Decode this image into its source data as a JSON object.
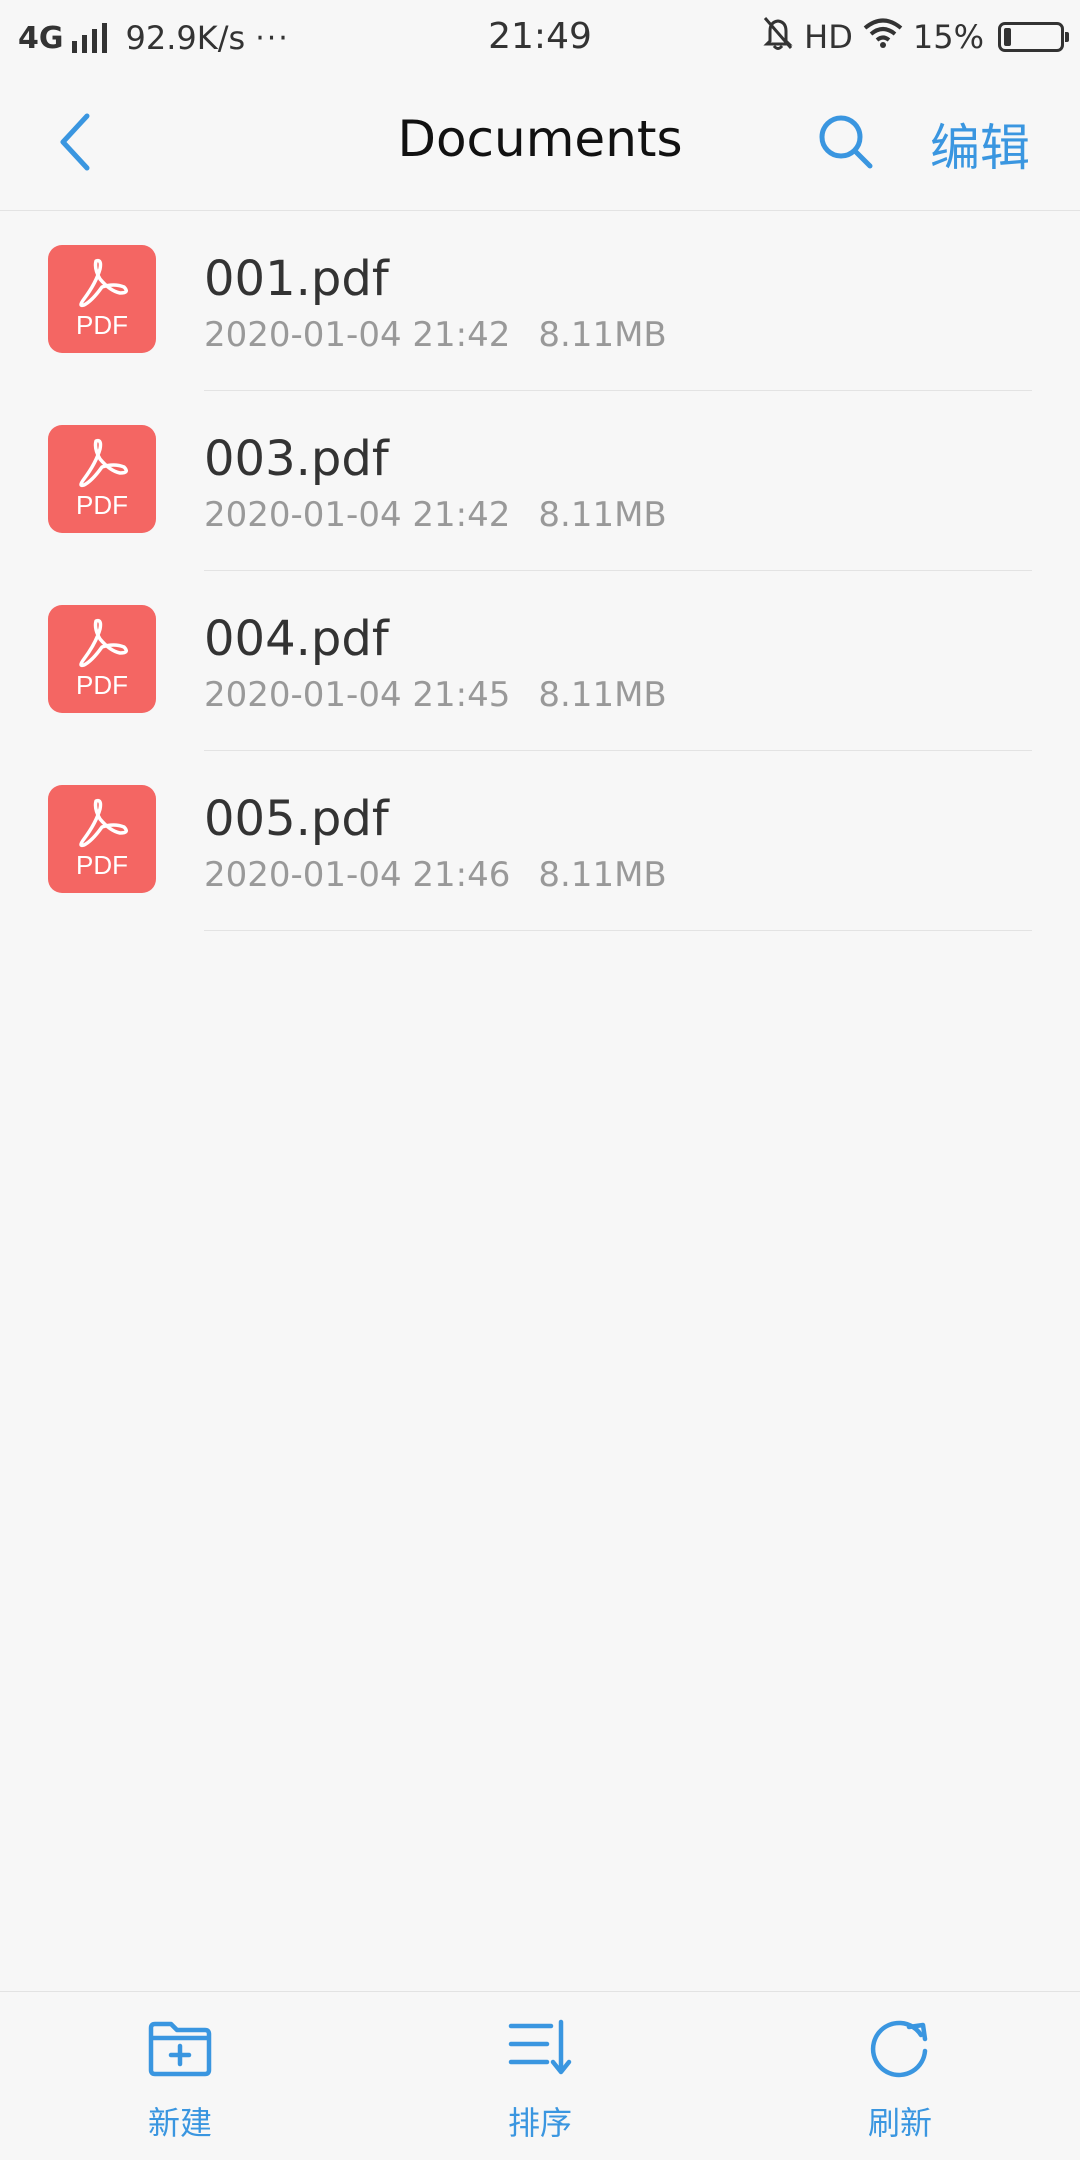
{
  "status_bar": {
    "network": "4G",
    "speed": "92.9K/s",
    "dots": "···",
    "time": "21:49",
    "hd": "HD",
    "battery": "15%",
    "icons": [
      "signal-icon",
      "mute-bell-icon",
      "wifi-icon",
      "battery-icon"
    ]
  },
  "nav": {
    "title": "Documents",
    "edit_label": "编辑",
    "accent": "#3a96e0"
  },
  "files": [
    {
      "name": "001.pdf",
      "date": "2020-01-04 21:42",
      "size": "8.11MB",
      "icon_label": "PDF"
    },
    {
      "name": "003.pdf",
      "date": "2020-01-04 21:42",
      "size": "8.11MB",
      "icon_label": "PDF"
    },
    {
      "name": "004.pdf",
      "date": "2020-01-04 21:45",
      "size": "8.11MB",
      "icon_label": "PDF"
    },
    {
      "name": "005.pdf",
      "date": "2020-01-04 21:46",
      "size": "8.11MB",
      "icon_label": "PDF"
    }
  ],
  "toolbar": {
    "new_label": "新建",
    "sort_label": "排序",
    "refresh_label": "刷新"
  },
  "colors": {
    "pdf_icon": "#f46663",
    "accent": "#3a96e0",
    "background": "#f7f7f7"
  }
}
